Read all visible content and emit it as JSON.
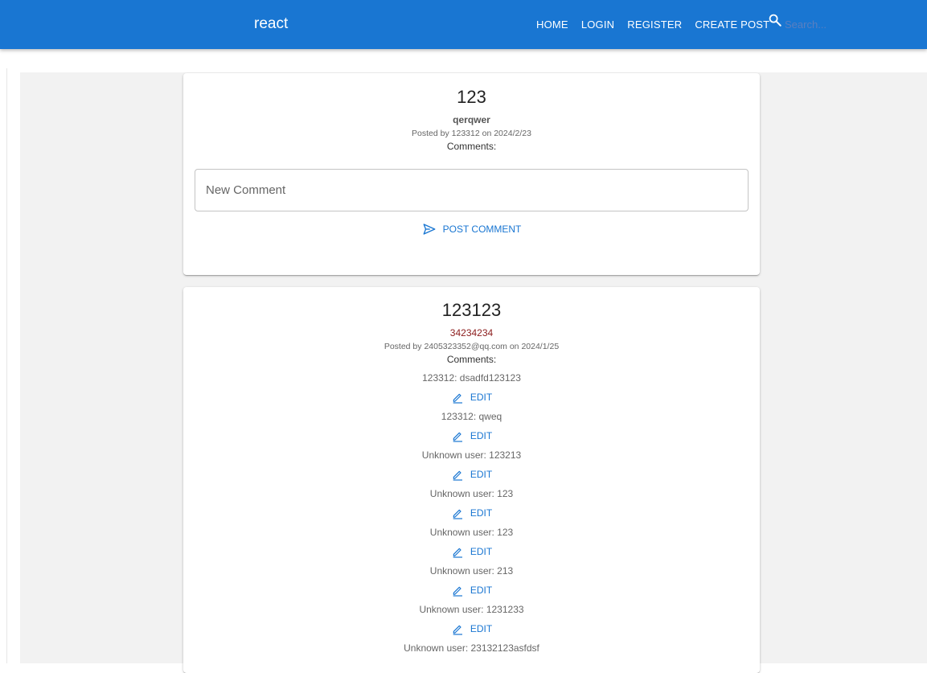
{
  "app": {
    "title": "react"
  },
  "nav": {
    "items": [
      "HOME",
      "LOGIN",
      "REGISTER",
      "CREATE POST"
    ],
    "search_placeholder": "Search..."
  },
  "posts": [
    {
      "title": "123",
      "body": "qerqwer",
      "meta": "Posted by 123312 on 2024/2/23",
      "comments_label": "Comments:",
      "new_comment_placeholder": "New Comment",
      "post_comment_label": "POST COMMENT"
    },
    {
      "title": "123123",
      "body": "34234234",
      "meta": "Posted by 2405323352@qq.com on 2024/1/25",
      "comments_label": "Comments:",
      "edit_label": "EDIT",
      "comments": [
        "123312: dsadfd123123",
        "123312: qweq",
        "Unknown user: 123213",
        "Unknown user: 123",
        "Unknown user: 123",
        "Unknown user: 213",
        "Unknown user: 1231233",
        "Unknown user: 23132123asfdsf"
      ]
    }
  ],
  "colors": {
    "appbar": "#1976d2",
    "accent": "#1976d2",
    "body_red": "#8b1c1c",
    "background": "#f2f2f2"
  },
  "icons": {
    "search": "search-icon",
    "send": "send-icon",
    "edit": "pencil-icon"
  }
}
